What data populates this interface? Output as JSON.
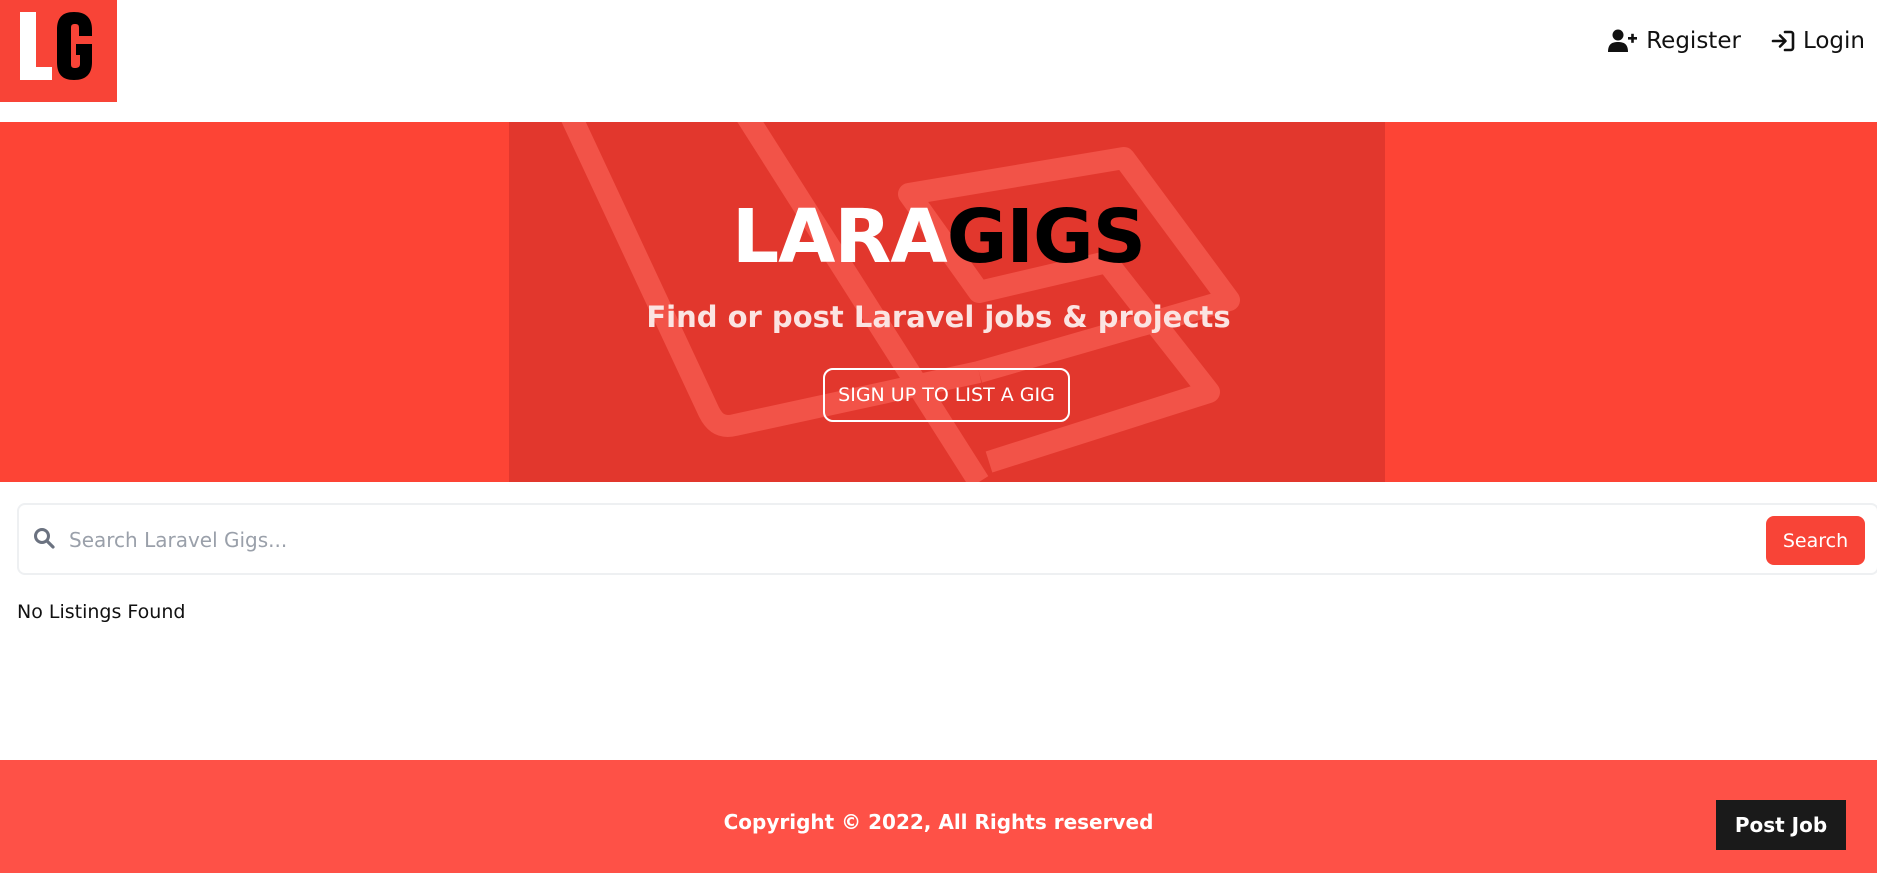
{
  "header": {
    "logo_text": "LG",
    "nav": [
      {
        "label": "Register",
        "icon": "user-plus-icon"
      },
      {
        "label": "Login",
        "icon": "sign-in-icon"
      }
    ]
  },
  "hero": {
    "title_part1": "LARA",
    "title_part2": "GIGS",
    "subtitle": "Find or post Laravel jobs & projects",
    "cta_label": "SIGN UP TO LIST A GIG"
  },
  "search": {
    "placeholder": "Search Laravel Gigs...",
    "value": "",
    "button_label": "Search",
    "icon": "search-icon"
  },
  "listings": {
    "empty_message": "No Listings Found"
  },
  "footer": {
    "copyright": "Copyright © 2022, All Rights reserved",
    "post_job_label": "Post Job"
  },
  "colors": {
    "brand_red": "#f84437",
    "hero_red": "#fd4435",
    "hero_panel": "#e2372d",
    "footer_red": "#fe5147",
    "dark": "#1a1a1a"
  }
}
